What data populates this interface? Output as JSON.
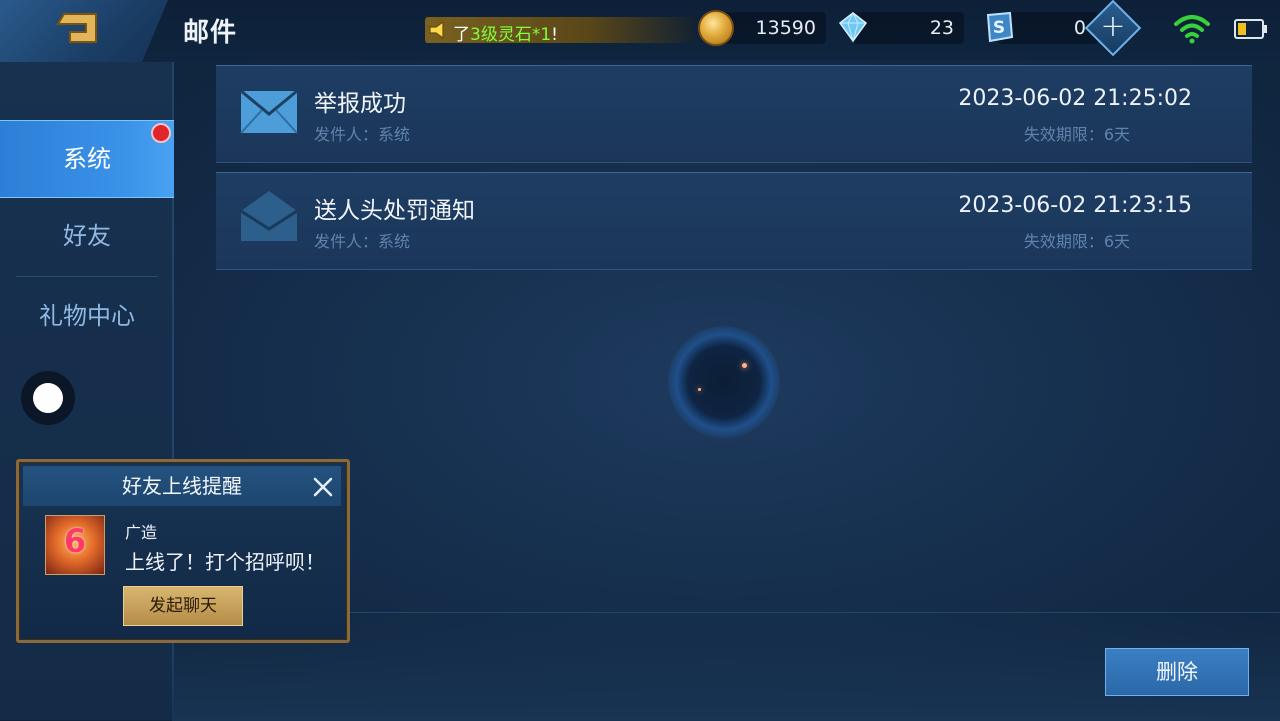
{
  "header": {
    "title": "邮件",
    "marquee": {
      "prefix": "了",
      "highlight": "3级灵石*1",
      "suffix": "!"
    },
    "resources": [
      {
        "name": "gold-coin",
        "value": "13590"
      },
      {
        "name": "diamond",
        "value": "23"
      },
      {
        "name": "s-ticket",
        "value": "0"
      }
    ]
  },
  "sidebar": {
    "items": [
      {
        "label": "系统",
        "active": true,
        "has_notification": true
      },
      {
        "label": "好友",
        "active": false
      },
      {
        "label": "礼物中心",
        "active": false
      }
    ]
  },
  "mails": [
    {
      "title": "举报成功",
      "sender": "发件人：系统",
      "date": "2023-06-02 21:25:02",
      "expire": "失效期限：6天",
      "read": false
    },
    {
      "title": "送人头处罚通知",
      "sender": "发件人：系统",
      "date": "2023-06-02 21:23:15",
      "expire": "失效期限：6天",
      "read": true
    }
  ],
  "popup": {
    "title": "好友上线提醒",
    "friend_name": "广造",
    "message": "上线了！打个招呼呗！",
    "chat_button": "发起聊天",
    "avatar_text": "6"
  },
  "actions": {
    "delete_label": "删除"
  },
  "colors": {
    "accent": "#3a92e8",
    "background": "#16304f",
    "gold": "#d8b670"
  }
}
